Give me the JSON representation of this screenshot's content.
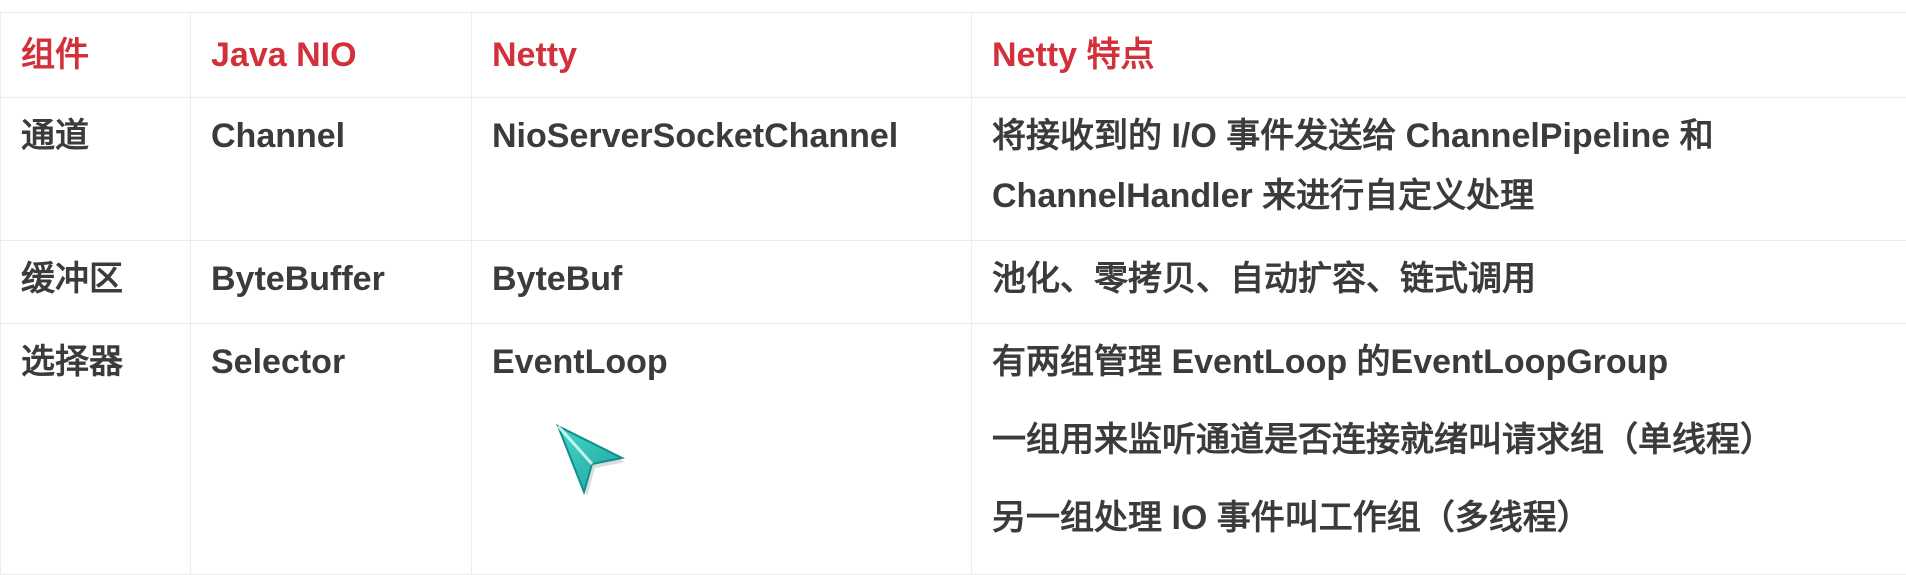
{
  "table": {
    "headers": [
      "组件",
      "Java NIO",
      "Netty",
      "Netty 特点"
    ],
    "rows": [
      {
        "component": "通道",
        "java_nio": "Channel",
        "netty": "NioServerSocketChannel",
        "features": [
          "将接收到的 I/O 事件发送给 ChannelPipeline 和",
          "ChannelHandler 来进行自定义处理"
        ]
      },
      {
        "component": "缓冲区",
        "java_nio": "ByteBuffer",
        "netty": "ByteBuf",
        "features": [
          "池化、零拷贝、自动扩容、链式调用"
        ]
      },
      {
        "component": "选择器",
        "java_nio": "Selector",
        "netty": "EventLoop",
        "features": [
          "有两组管理 EventLoop 的EventLoopGroup",
          "一组用来监听通道是否连接就绪叫请求组（单线程）",
          "另一组处理 IO 事件叫工作组（多线程）"
        ]
      }
    ]
  },
  "colors": {
    "header_text": "#d2303a",
    "body_text": "#3b3b3b",
    "border": "#ececec",
    "cursor": "#1fb5ad"
  },
  "icons": {
    "cursor": "mouse-pointer-icon"
  }
}
